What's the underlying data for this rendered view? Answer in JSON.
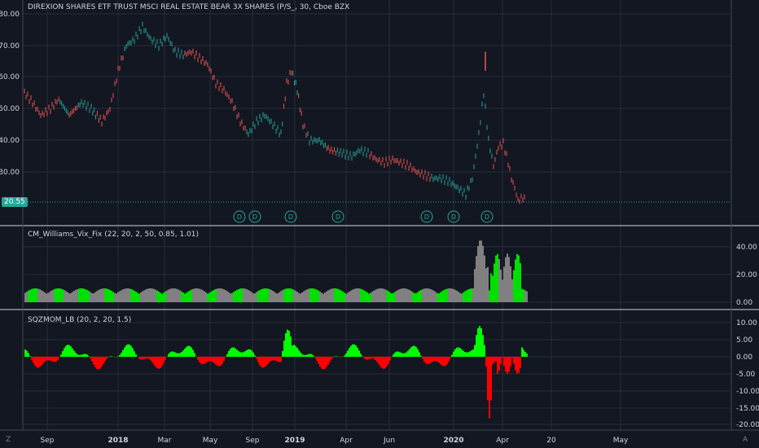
{
  "symbol_title": "DIREXION SHARES ETF TRUST MSCI REAL ESTATE BEAR 3X SHARES (P/S_, 30, Cboe BZX",
  "current_price": "20.55",
  "price_axis": [
    "80.00",
    "70.00",
    "60.00",
    "50.00",
    "40.00",
    "30.00"
  ],
  "dividend_marker": "D",
  "indicators": [
    {
      "label": "CM_Williams_Vix_Fix (22, 20, 2, 50, 0.85, 1.01)",
      "axis": [
        "40.00",
        "20.00",
        "0.00"
      ]
    },
    {
      "label": "SQZMOM_LB (20, 2, 20, 1.5)",
      "axis": [
        "10.00",
        "5.00",
        "0.00",
        "-5.00",
        "-10.00",
        "-15.00",
        "-20.00"
      ]
    }
  ],
  "time_axis": [
    "Sep",
    "2018",
    "Mar",
    "May",
    "Sep",
    "2019",
    "Apr",
    "Jun",
    "2020",
    "Apr",
    "20",
    "May"
  ],
  "corner_left": "Z",
  "corner_right": "A",
  "colors": {
    "background": "#131722",
    "grid": "#2a2e39",
    "up": "#26a69a",
    "down": "#ef5350",
    "vix_green": "#00e000",
    "vix_gray": "#808080",
    "sqz_green": "#00ff00",
    "sqz_red": "#ff0000",
    "axis_text": "#d1d4dc"
  }
}
